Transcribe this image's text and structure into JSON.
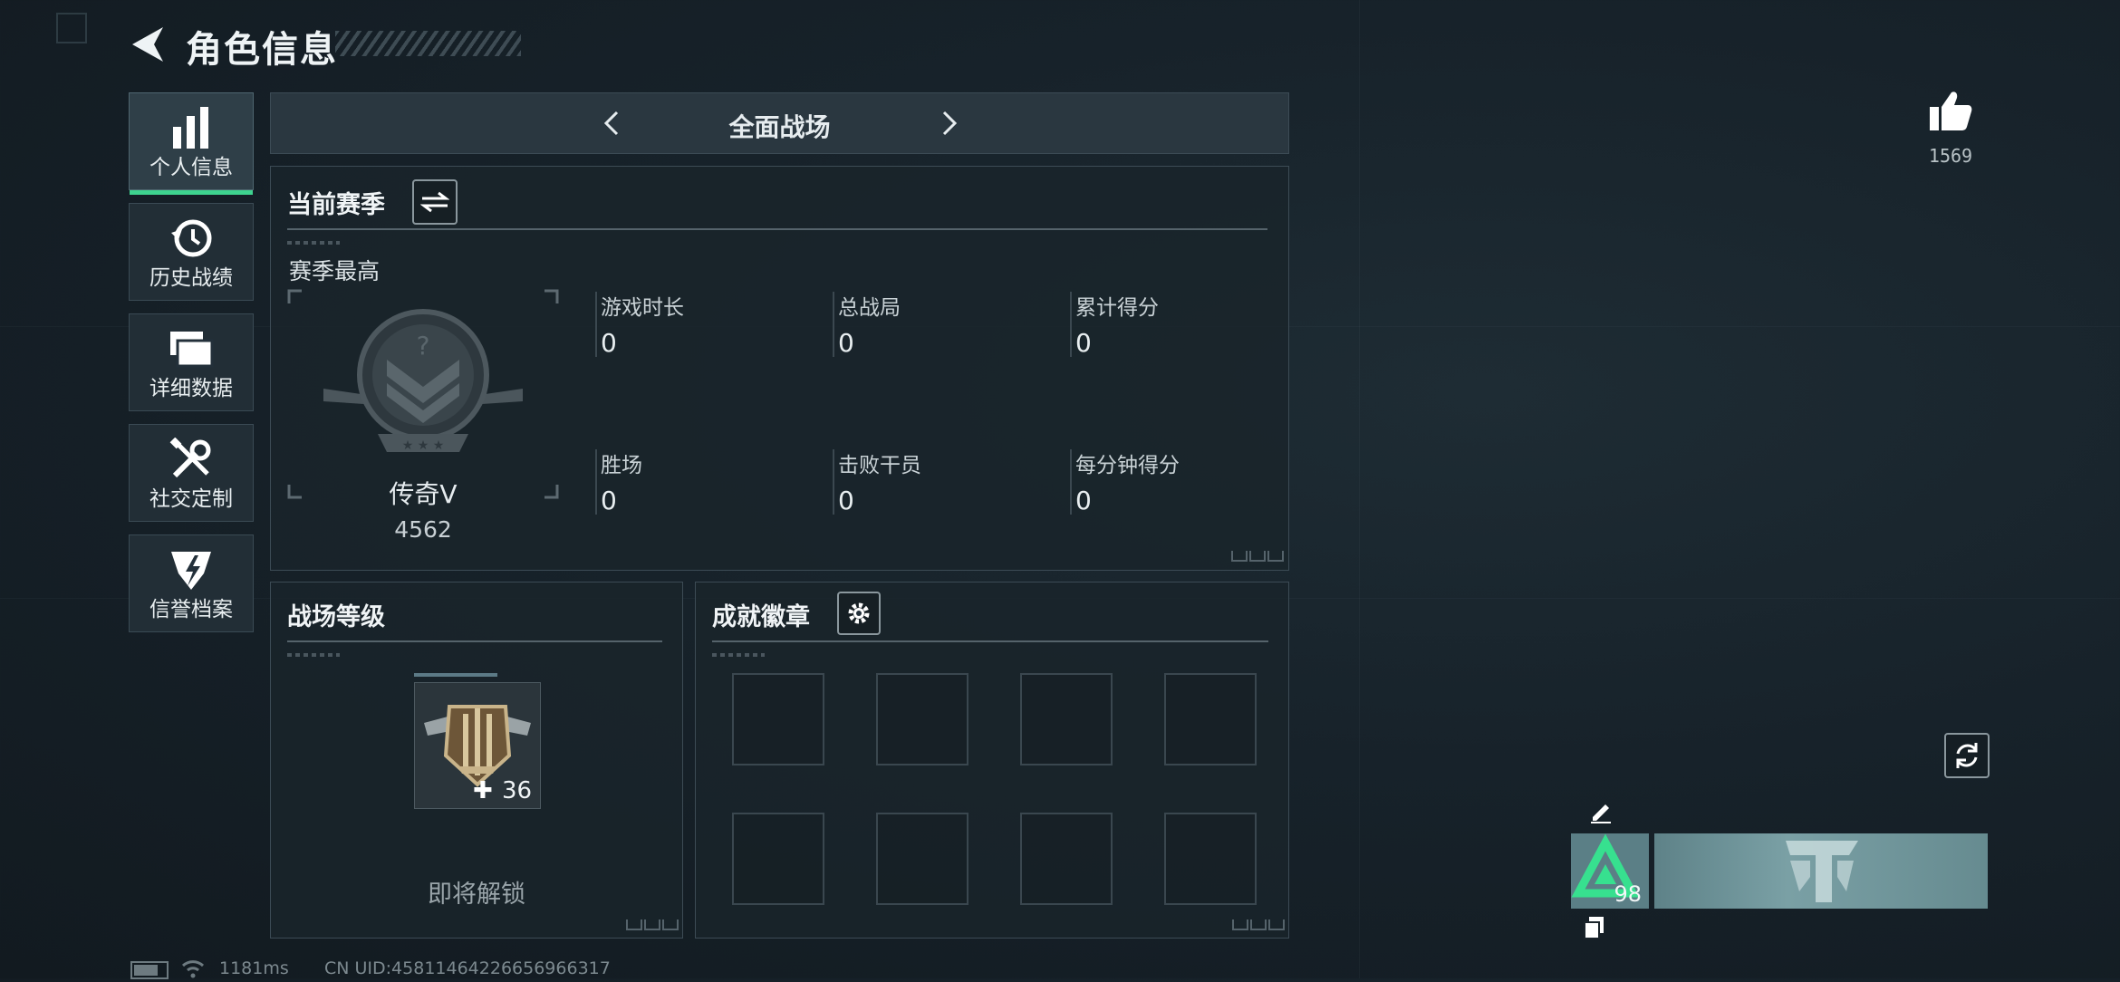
{
  "header": {
    "title": "角色信息"
  },
  "sidebar": {
    "items": [
      {
        "label": "个人信息",
        "icon": "bar-chart-icon",
        "active": true
      },
      {
        "label": "历史战绩",
        "icon": "history-icon",
        "active": false
      },
      {
        "label": "详细数据",
        "icon": "stacked-folders-icon",
        "active": false
      },
      {
        "label": "社交定制",
        "icon": "tools-icon",
        "active": false
      },
      {
        "label": "信誉档案",
        "icon": "reputation-emblem-icon",
        "active": false
      }
    ]
  },
  "mode_tabs": {
    "current": "全面战场"
  },
  "season": {
    "heading": "当前赛季",
    "peak_label": "赛季最高",
    "rank_name": "传奇V",
    "rank_points": "4562",
    "stats": [
      {
        "label": "游戏时长",
        "value": "0"
      },
      {
        "label": "总战局",
        "value": "0"
      },
      {
        "label": "累计得分",
        "value": "0"
      },
      {
        "label": "胜场",
        "value": "0"
      },
      {
        "label": "击败干员",
        "value": "0"
      },
      {
        "label": "每分钟得分",
        "value": "0"
      }
    ]
  },
  "battle_level": {
    "heading": "战场等级",
    "level": "36",
    "unlock_text": "即将解锁"
  },
  "achievements": {
    "heading": "成就徽章",
    "slots": 8
  },
  "likes": {
    "count": "1569"
  },
  "profile_card": {
    "level": "98"
  },
  "status_bar": {
    "ping": "1181ms",
    "uid": "CN UID:45811464226656966317"
  },
  "colors": {
    "accent_green": "#3ed38f",
    "panel_bg": "#1a242b",
    "border": "#3c4b55"
  }
}
